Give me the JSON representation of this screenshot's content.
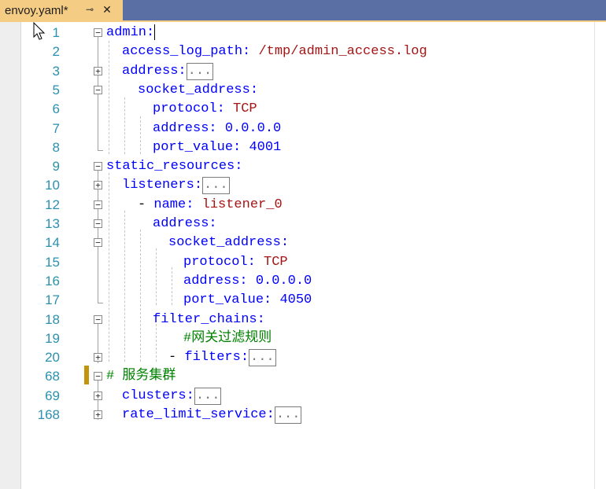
{
  "tab": {
    "title": "envoy.yaml*",
    "pin_icon": "pin-icon",
    "close_icon": "close-icon",
    "pin_glyph": "⊸",
    "close_glyph": "✕"
  },
  "editor": {
    "lines": [
      {
        "num": "1",
        "key": "admin",
        "sep": ":",
        "val": ""
      },
      {
        "num": "2",
        "key": "access_log_path",
        "sep": ": ",
        "val": "/tmp/admin_access.log"
      },
      {
        "num": "3",
        "key": "address",
        "sep": ":",
        "val": "..."
      },
      {
        "num": "5",
        "key": "socket_address",
        "sep": ":",
        "val": ""
      },
      {
        "num": "6",
        "key": "protocol",
        "sep": ": ",
        "val": "TCP"
      },
      {
        "num": "7",
        "key": "address",
        "sep": ": ",
        "val": "0.0.0.0"
      },
      {
        "num": "8",
        "key": "port_value",
        "sep": ": ",
        "val": "4001"
      },
      {
        "num": "9",
        "key": "static_resources",
        "sep": ":",
        "val": ""
      },
      {
        "num": "10",
        "key": "listeners",
        "sep": ":",
        "val": "..."
      },
      {
        "num": "12",
        "key": "name",
        "sep": ": ",
        "val": "listener_0",
        "dash": "- "
      },
      {
        "num": "13",
        "key": "address",
        "sep": ":",
        "val": ""
      },
      {
        "num": "14",
        "key": "socket_address",
        "sep": ":",
        "val": ""
      },
      {
        "num": "15",
        "key": "protocol",
        "sep": ": ",
        "val": "TCP"
      },
      {
        "num": "16",
        "key": "address",
        "sep": ": ",
        "val": "0.0.0.0"
      },
      {
        "num": "17",
        "key": "port_value",
        "sep": ": ",
        "val": "4050"
      },
      {
        "num": "18",
        "key": "filter_chains",
        "sep": ":",
        "val": ""
      },
      {
        "num": "19",
        "comment": "#网关过滤规则"
      },
      {
        "num": "20",
        "key": "filters",
        "sep": ":",
        "val": "...",
        "dash": "- "
      },
      {
        "num": "68",
        "comment": "# 服务集群"
      },
      {
        "num": "69",
        "key": "clusters",
        "sep": ":",
        "val": "..."
      },
      {
        "num": "168",
        "key": "rate_limit_service",
        "sep": ":",
        "val": "..."
      }
    ]
  }
}
